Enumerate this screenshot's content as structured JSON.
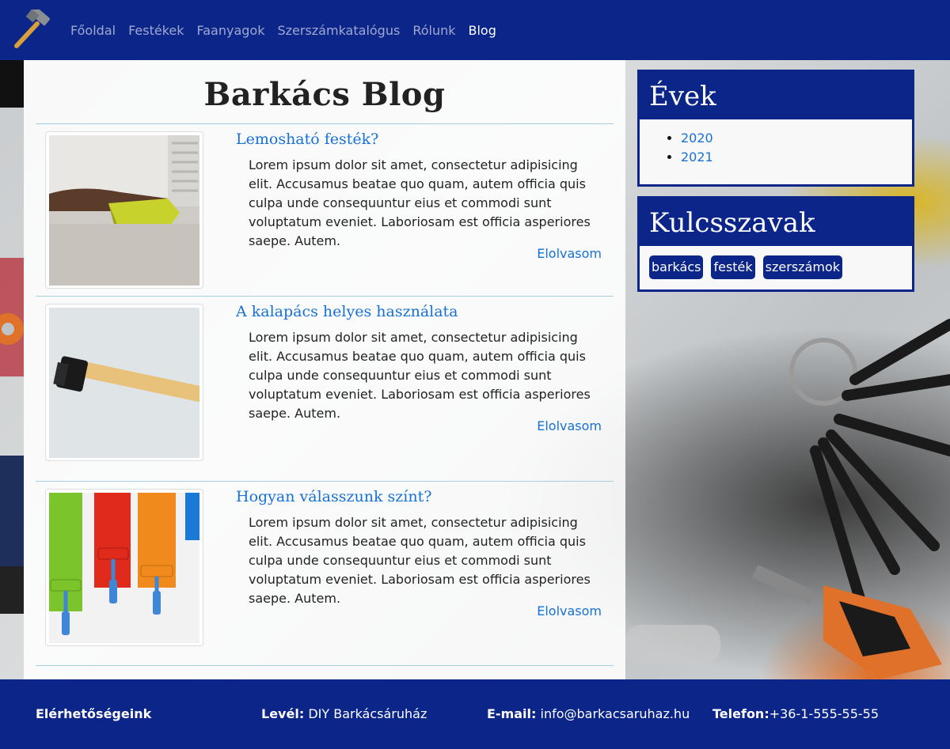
{
  "nav": {
    "items": [
      "Főoldal",
      "Festékek",
      "Faanyagok",
      "Szerszámkatalógus",
      "Rólunk",
      "Blog"
    ],
    "active": "Blog",
    "logo_icon": "hammer-icon"
  },
  "main": {
    "title": "Barkács Blog",
    "posts": [
      {
        "title": "Lemosható festék?",
        "text": "Lorem ipsum dolor sit amet, consectetur adipisicing elit. Accusamus beatae quo quam, autem officia quis culpa unde consequuntur eius et commodi sunt voluptatum eveniet. Laboriosam est officia asperiores saepe. Autem.",
        "read_more": "Elolvasom",
        "image": "sponge-cleaning-photo"
      },
      {
        "title": "A kalapács helyes használata",
        "text": "Lorem ipsum dolor sit amet, consectetur adipisicing elit. Accusamus beatae quo quam, autem officia quis culpa unde consequuntur eius et commodi sunt voluptatum eveniet. Laboriosam est officia asperiores saepe. Autem.",
        "read_more": "Elolvasom",
        "image": "hammer-photo"
      },
      {
        "title": "Hogyan válasszunk színt?",
        "text": "Lorem ipsum dolor sit amet, consectetur adipisicing elit. Accusamus beatae quo quam, autem officia quis culpa unde consequuntur eius et commodi sunt voluptatum eveniet. Laboriosam est officia asperiores saepe. Autem.",
        "read_more": "Elolvasom",
        "image": "paint-rollers-photo"
      }
    ]
  },
  "sidebar": {
    "years_title": "Évek",
    "years": [
      "2020",
      "2021"
    ],
    "keywords_title": "Kulcsszavak",
    "keywords": [
      "barkács",
      "festék",
      "szerszámok"
    ]
  },
  "footer": {
    "contacts_label": "Elérhetőségeink",
    "mail_label": "Levél:",
    "mail_value": "DIY Barkácsáruház",
    "email_label": "E-mail:",
    "email_value": "info@barkacsaruhaz.hu",
    "phone_label": "Telefon:",
    "phone_value": "+36-1-555-55-55"
  },
  "colors": {
    "brand": "#0b2589",
    "link": "#1671d6"
  }
}
